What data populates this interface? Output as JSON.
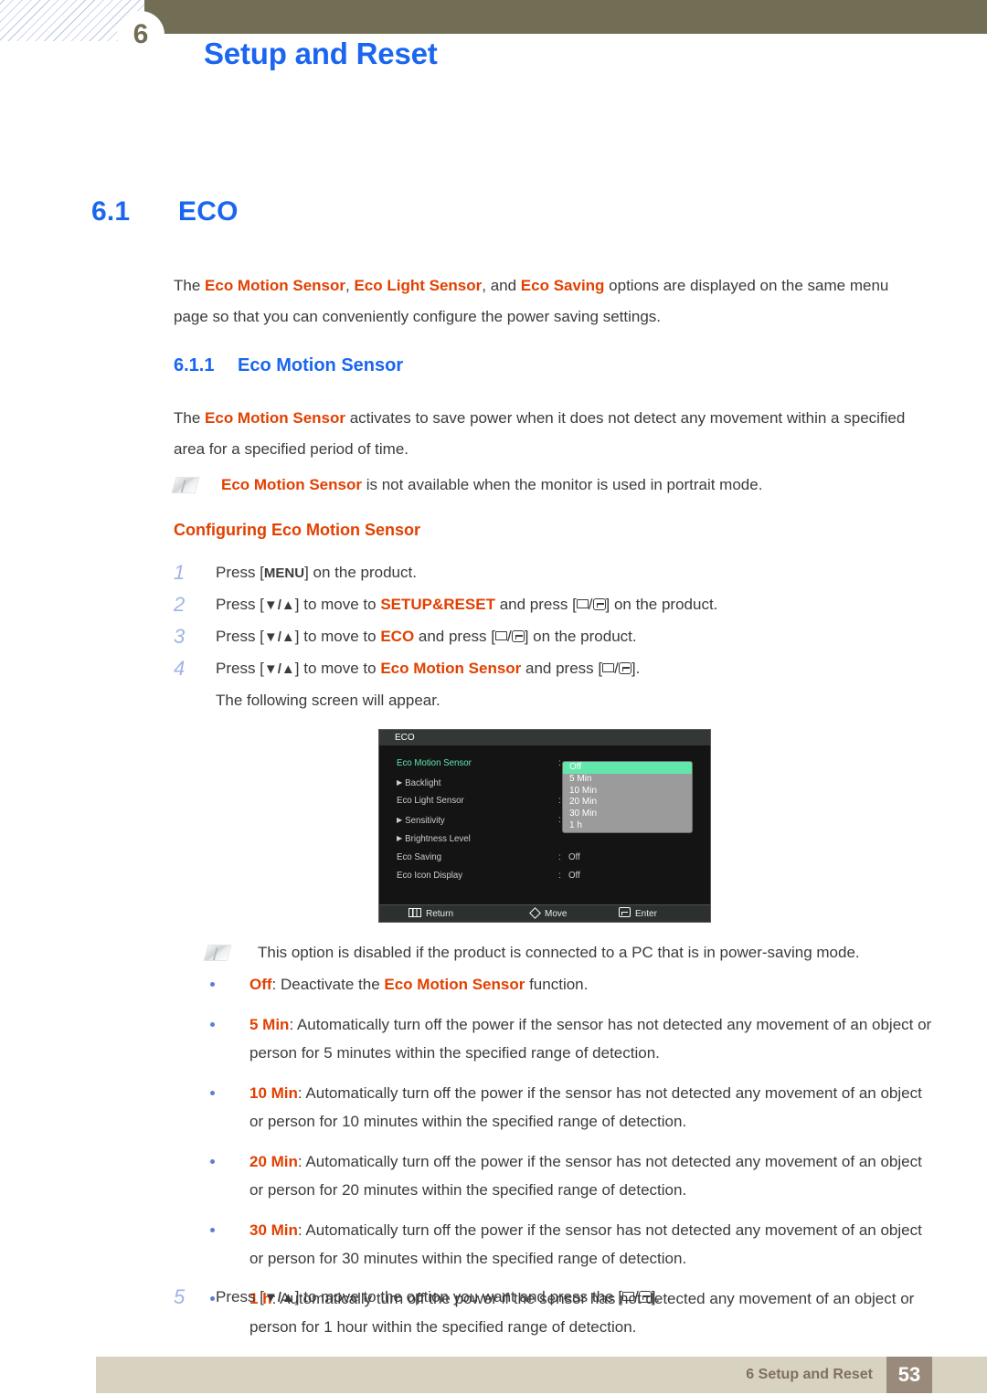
{
  "header": {
    "chapter_number": "6",
    "title": "Setup and Reset"
  },
  "section": {
    "number": "6.1",
    "title": "ECO",
    "intro_parts": {
      "t1": "The ",
      "hl1": "Eco Motion Sensor",
      "t2": ", ",
      "hl2": "Eco Light Sensor",
      "t3": ", and ",
      "hl3": "Eco Saving",
      "t4": " options are displayed on the same menu page so that you can conveniently configure the power saving settings."
    }
  },
  "subsection": {
    "number": "6.1.1",
    "title": "Eco Motion Sensor",
    "paragraph": {
      "t1": "The ",
      "hl1": "Eco Motion Sensor",
      "t2": " activates to save power when it does not detect any movement within a specified area for a specified period of time."
    },
    "note1": {
      "hl1": "Eco Motion Sensor",
      "t1": " is not available when the monitor is used in portrait mode."
    },
    "procedure_title": "Configuring Eco Motion Sensor"
  },
  "steps": [
    {
      "num": "1",
      "t1": "Press [",
      "key": "MENU",
      "t2": "] on the product."
    },
    {
      "num": "2",
      "t1": "Press [",
      "key": "▼/▲",
      "t2": "] to move to ",
      "hl": "SETUP&RESET",
      "t3": " and press [",
      "t4": "] on the product."
    },
    {
      "num": "3",
      "t1": "Press [",
      "key": "▼/▲",
      "t2": "] to move to ",
      "hl": "ECO",
      "t3": " and press [",
      "t4": "] on the product."
    },
    {
      "num": "4",
      "t1": "Press [",
      "key": "▼/▲",
      "t2": "] to move to ",
      "hl": "Eco Motion Sensor",
      "t3": " and press [",
      "t4": "]."
    }
  ],
  "step4_followup": "The following screen will appear.",
  "step5": {
    "num": "5",
    "t1": "Press [",
    "key": "▼/▲",
    "t2": "] to move to the option you want and press the [",
    "t3": "]."
  },
  "osd": {
    "title": "ECO",
    "rows": [
      {
        "label": "Eco Motion Sensor",
        "arrow": "",
        "colon": ":",
        "value": "",
        "active": true
      },
      {
        "label": "Backlight",
        "arrow": "▶",
        "colon": "",
        "value": "",
        "active": false
      },
      {
        "label": "Eco Light Sensor",
        "arrow": "",
        "colon": ":",
        "value": "",
        "active": false
      },
      {
        "label": "Sensitivity",
        "arrow": "▶",
        "colon": ":",
        "value": "",
        "active": false
      },
      {
        "label": "Brightness Level",
        "arrow": "▶",
        "colon": "",
        "value": "",
        "active": false
      },
      {
        "label": "Eco Saving",
        "arrow": "",
        "colon": ":",
        "value": "Off",
        "active": false
      },
      {
        "label": "Eco Icon Display",
        "arrow": "",
        "colon": ":",
        "value": "Off",
        "active": false
      }
    ],
    "dropdown": {
      "options": [
        "Off",
        "5 Min",
        "10 Min",
        "20 Min",
        "30 Min",
        "1 h"
      ],
      "selected": "Off",
      "selected_color": "#63e6ab",
      "background_color": "#9b9b9b"
    },
    "footer": {
      "return": "Return",
      "move": "Move",
      "enter": "Enter"
    }
  },
  "note2": {
    "text": "This option is disabled if the product is connected to a PC that is in power-saving mode."
  },
  "bullets": [
    {
      "hl": "Off",
      "t1": ": Deactivate the ",
      "hl2": "Eco Motion Sensor",
      "t2": " function."
    },
    {
      "hl": "5 Min",
      "t1": ": Automatically turn off the power if the sensor has not detected any movement of an object or person for 5 minutes within the specified range of detection."
    },
    {
      "hl": "10 Min",
      "t1": ": Automatically turn off the power if the sensor has not detected any movement of an object or person for 10 minutes within the specified range of detection."
    },
    {
      "hl": "20 Min",
      "t1": ": Automatically turn off the power if the sensor has not detected any movement of an object or person for 20 minutes within the specified range of detection."
    },
    {
      "hl": "30 Min",
      "t1": ": Automatically turn off the power if the sensor has not detected any movement of an object or person for 30 minutes within the specified range of detection."
    },
    {
      "hl": "1 h",
      "t1": ": Automatically turn off the power if the sensor has not detected any movement of an object or person for 1 hour within the specified range of detection."
    }
  ],
  "footer": {
    "text": "6 Setup and Reset",
    "page": "53"
  },
  "colors": {
    "header_bar": "#726e55",
    "heading_blue": "#1a66f0",
    "highlight_orange": "#e24000",
    "footer_bar": "#d8d2c0",
    "footer_page_box": "#9a8a7c",
    "step_number": "#9fb3e6",
    "bullet_dot": "#5b7fd4"
  }
}
